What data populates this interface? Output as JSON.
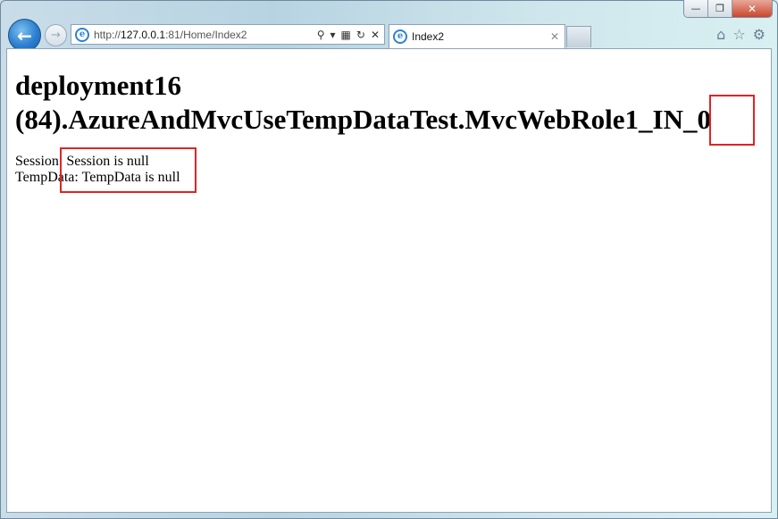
{
  "browser": {
    "url_prefix": "http://",
    "url_host": "127.0.0.1",
    "url_rest": ":81/Home/Index2",
    "tab_title": "Index2"
  },
  "page": {
    "title": "deployment16 (84).AzureAndMvcUseTempDataTest.MvcWebRole1_IN_0",
    "session_label": "Session:",
    "session_value": "Session is null",
    "tempdata_label": "TempData:",
    "tempdata_value": "TempData is null"
  },
  "colors": {
    "annotation": "#e02424",
    "accent": "#2a7fcf"
  }
}
